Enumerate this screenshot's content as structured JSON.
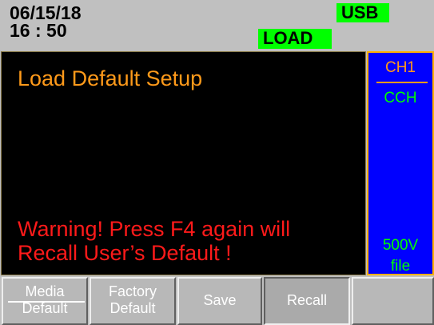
{
  "status": {
    "date": "06/15/18",
    "time": "16 : 50",
    "usb": "USB",
    "load": "LOAD"
  },
  "main": {
    "title": "Load Default Setup",
    "warning_line1": "Warning! Press F4 again will",
    "warning_line2": "Recall User’s Default !"
  },
  "side": {
    "channel": "CH1",
    "mode": "CCH",
    "voltage": "500V",
    "file": "file"
  },
  "softkeys": [
    {
      "line1": "Media",
      "line2": "Default"
    },
    {
      "line1": "Factory",
      "line2": "Default"
    },
    {
      "label": "Save"
    },
    {
      "label": "Recall"
    },
    {
      "label": ""
    }
  ],
  "colors": {
    "title": "#ff9a1a",
    "warning": "#ff1a1a",
    "badge": "#00ff00",
    "side_bg": "#0000ff"
  }
}
